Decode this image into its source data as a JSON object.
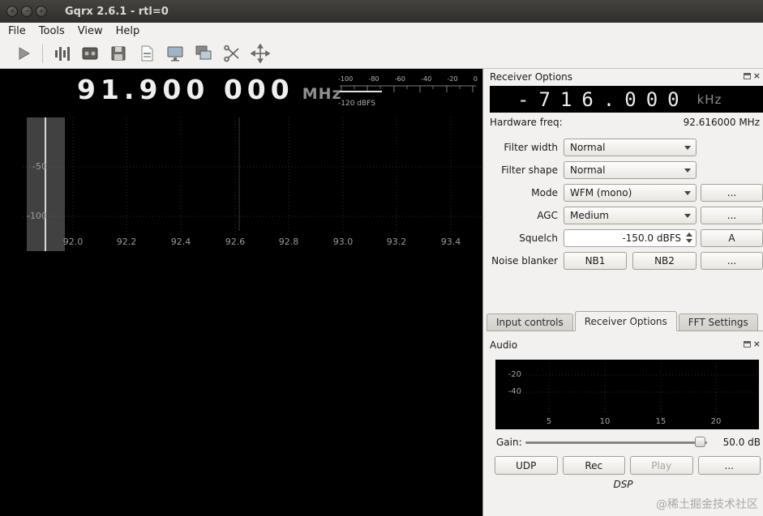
{
  "window": {
    "title": "Gqrx 2.6.1 - rtl=0",
    "controls": [
      {
        "name": "close-icon",
        "glyph": "×"
      },
      {
        "name": "minimize-icon",
        "glyph": "−"
      },
      {
        "name": "maximize-icon",
        "glyph": "+"
      }
    ]
  },
  "menu": {
    "items": [
      "File",
      "Tools",
      "View",
      "Help"
    ]
  },
  "toolbar": {
    "icons": [
      "start-dsp",
      "record-iq",
      "open-file",
      "save",
      "bookmarks",
      "screenshot",
      "remote-control",
      "edit",
      "fullscreen"
    ]
  },
  "frequency": {
    "value": "91.900 000",
    "unit": "MHz"
  },
  "smeter": {
    "ticks": [
      "-100",
      "-80",
      "-60",
      "-40",
      "-20",
      "0"
    ],
    "floor_label": "-120 dBFS"
  },
  "spectrum": {
    "db_ticks": [
      "-50",
      "-100"
    ],
    "freq_ticks": [
      "92.0",
      "92.2",
      "92.4",
      "92.6",
      "92.8",
      "93.0",
      "93.2",
      "93.4"
    ]
  },
  "receiver": {
    "title": "Receiver Options",
    "offset": {
      "value": "-716.000",
      "unit": "kHz"
    },
    "hardware_freq": {
      "label": "Hardware freq:",
      "value": "92.616000 MHz"
    },
    "filter_width": {
      "label": "Filter width",
      "value": "Normal"
    },
    "filter_shape": {
      "label": "Filter shape",
      "value": "Normal"
    },
    "mode": {
      "label": "Mode",
      "value": "WFM (mono)",
      "more": "..."
    },
    "agc": {
      "label": "AGC",
      "value": "Medium",
      "more": "..."
    },
    "squelch": {
      "label": "Squelch",
      "value": "-150.0 dBFS",
      "auto": "A"
    },
    "noise_blanker": {
      "label": "Noise blanker",
      "nb1": "NB1",
      "nb2": "NB2",
      "more": "..."
    }
  },
  "tabs": {
    "items": [
      "Input controls",
      "Receiver Options",
      "FFT Settings"
    ],
    "active_index": 1
  },
  "audio": {
    "title": "Audio",
    "db_ticks": [
      "-20",
      "-40"
    ],
    "freq_ticks": [
      "5",
      "10",
      "15",
      "20"
    ],
    "gain": {
      "label": "Gain:",
      "value": "50.0 dB"
    },
    "buttons": {
      "udp": "UDP",
      "rec": "Rec",
      "play": "Play",
      "more": "..."
    }
  },
  "status": {
    "dsp": "DSP"
  },
  "watermark": "@稀土掘金技术社区",
  "ui_icons": {
    "close_glyph": "×"
  },
  "colors": {
    "panel_bg": "#f2f1ef",
    "lcd_bg": "#000000",
    "lcd_digit": "#ececec",
    "plot_bg": "#000000"
  }
}
